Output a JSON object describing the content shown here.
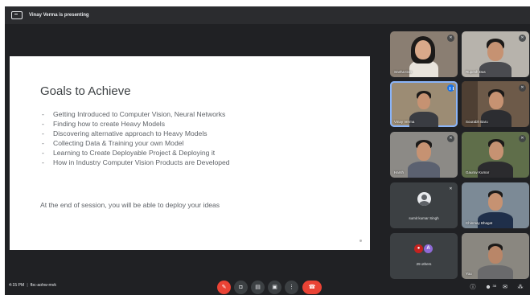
{
  "presenter": {
    "text": "Vinay Verma is presenting",
    "icon": "present-screen-icon"
  },
  "slide": {
    "title": "Goals to Achieve",
    "bullets": [
      "Getting Introduced to Computer Vision, Neural Networks",
      "Finding how to create Heavy Models",
      "Discovering alternative approach to Heavy Models",
      "Collecting Data & Training your own Model",
      "Learning to Create Deployable Project & Deploying it",
      "How in Industry Computer Vision Products are Developed"
    ],
    "footer": "At the end of session, you will be able to deploy your ideas"
  },
  "participants": [
    {
      "name": "Sneha Das",
      "muted": true
    },
    {
      "name": "Rupesh Das",
      "muted": true
    },
    {
      "name": "Vinay Verma",
      "speaking": true
    },
    {
      "name": "Sourabh Baru",
      "muted": true
    },
    {
      "name": "Harsh",
      "muted": true
    },
    {
      "name": "Gaurav Kumar",
      "muted": true
    },
    {
      "name": "sumit kumar Singh",
      "muted": true
    },
    {
      "name": "Chinmay Bhagat",
      "muted": false
    },
    {
      "name": "29 others",
      "avatar_letter": "A"
    },
    {
      "name": "You"
    }
  ],
  "meeting": {
    "time": "4:15 PM",
    "code": "fbc-aohw-mvk"
  },
  "controls": {
    "mic_icon": "mic-off-icon",
    "cam_icon": "camera-icon",
    "captions_icon": "captions-icon",
    "present_icon": "present-now-icon",
    "more_icon": "more-options-icon",
    "end_icon": "end-call-icon"
  },
  "right_controls": {
    "people_count": "38"
  },
  "colors": {
    "accent": "#1a73e8",
    "end_call": "#ea4335",
    "background": "#202124"
  }
}
